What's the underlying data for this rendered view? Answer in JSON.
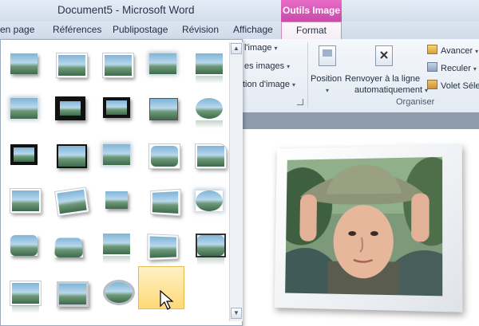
{
  "window": {
    "title": "Document5  -  Microsoft Word",
    "context_group": "Outils Image"
  },
  "tabs": [
    {
      "label": "en page"
    },
    {
      "label": "Références"
    },
    {
      "label": "Publipostage"
    },
    {
      "label": "Révision"
    },
    {
      "label": "Affichage"
    },
    {
      "label": "Format",
      "active": true
    }
  ],
  "ribbon": {
    "partial_items": [
      "l'image",
      "es images",
      "tion d'image"
    ],
    "position_label": "Position",
    "wrap_label_1": "Renvoyer à la ligne",
    "wrap_label_2": "automatiquement",
    "avancer": "Avancer",
    "reculer": "Reculer",
    "volet": "Volet Séle",
    "group_label": "Organiser"
  },
  "gallery": {
    "styles": [
      {
        "row": 0,
        "col": 0,
        "style": "simple-frame"
      },
      {
        "row": 0,
        "col": 1,
        "style": "white-frame"
      },
      {
        "row": 0,
        "col": 2,
        "style": "white-frame"
      },
      {
        "row": 0,
        "col": 3,
        "style": "soft-edge"
      },
      {
        "row": 0,
        "col": 4,
        "style": "reflected"
      },
      {
        "row": 1,
        "col": 0,
        "style": "soft-edge"
      },
      {
        "row": 1,
        "col": 1,
        "style": "thick-black-frame"
      },
      {
        "row": 1,
        "col": 2,
        "style": "black-frame"
      },
      {
        "row": 1,
        "col": 3,
        "style": "shadow"
      },
      {
        "row": 1,
        "col": 4,
        "style": "oval-reflected"
      },
      {
        "row": 2,
        "col": 0,
        "style": "black-frame"
      },
      {
        "row": 2,
        "col": 1,
        "style": "black-frame"
      },
      {
        "row": 2,
        "col": 2,
        "style": "glow"
      },
      {
        "row": 2,
        "col": 3,
        "style": "rounded"
      },
      {
        "row": 2,
        "col": 4,
        "style": "snipped"
      },
      {
        "row": 3,
        "col": 0,
        "style": "soft-edge"
      },
      {
        "row": 3,
        "col": 1,
        "style": "rotated-white"
      },
      {
        "row": 3,
        "col": 2,
        "style": "shadow"
      },
      {
        "row": 3,
        "col": 3,
        "style": "perspective"
      },
      {
        "row": 3,
        "col": 4,
        "style": "oval-soft"
      },
      {
        "row": 4,
        "col": 0,
        "style": "bevel"
      },
      {
        "row": 4,
        "col": 1,
        "style": "bevel-perspective"
      },
      {
        "row": 4,
        "col": 2,
        "style": "reflected"
      },
      {
        "row": 4,
        "col": 3,
        "style": "perspective-white",
        "selected": true
      },
      {
        "row": 4,
        "col": 4,
        "style": "rounded-reflected"
      },
      {
        "row": 5,
        "col": 0,
        "style": "white-frame"
      },
      {
        "row": 5,
        "col": 1,
        "style": "metal-frame"
      },
      {
        "row": 5,
        "col": 2,
        "style": "oval-metal"
      }
    ]
  },
  "icons": {
    "scroll_up": "▲",
    "scroll_down": "▼"
  },
  "colors": {
    "context_accent": "#d35bb6",
    "selection": "#ffd978"
  }
}
